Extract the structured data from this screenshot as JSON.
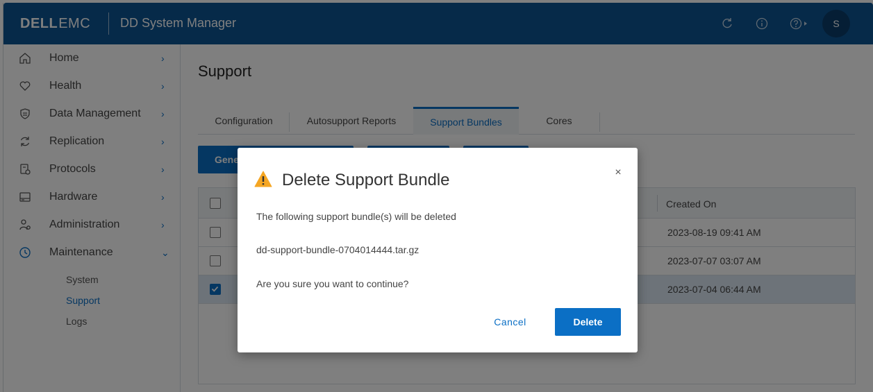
{
  "header": {
    "brand_dell": "DELL",
    "brand_emc": "EMC",
    "app_title": "DD System Manager",
    "avatar_initial": "S",
    "icons": [
      "refresh-icon",
      "info-icon",
      "help-icon"
    ]
  },
  "sidebar": {
    "items": [
      {
        "label": "Home",
        "icon": "home-icon"
      },
      {
        "label": "Health",
        "icon": "heart-icon"
      },
      {
        "label": "Data Management",
        "icon": "shield-icon"
      },
      {
        "label": "Replication",
        "icon": "replication-icon"
      },
      {
        "label": "Protocols",
        "icon": "protocols-icon"
      },
      {
        "label": "Hardware",
        "icon": "drive-icon"
      },
      {
        "label": "Administration",
        "icon": "admin-user-icon"
      },
      {
        "label": "Maintenance",
        "icon": "clock-icon"
      }
    ],
    "sub_items": [
      "System",
      "Support",
      "Logs"
    ],
    "active_sub": "Support"
  },
  "main": {
    "page_title": "Support",
    "tabs": [
      "Configuration",
      "Autosupport Reports",
      "Support Bundles",
      "Cores"
    ],
    "active_tab": "Support Bundles",
    "toolbar": {
      "generate_label": "Gene"
    },
    "table": {
      "header_created_on": "Created On",
      "rows": [
        {
          "created_on": "2023-08-19 09:41 AM",
          "checked": false
        },
        {
          "created_on": "2023-07-07 03:07 AM",
          "checked": false
        },
        {
          "created_on": "2023-07-04 06:44 AM",
          "checked": true
        }
      ]
    }
  },
  "modal": {
    "title": "Delete Support Bundle",
    "message": "The following support bundle(s) will be deleted",
    "bundle_name": "dd-support-bundle-0704014444.tar.gz",
    "confirm_text": "Are you sure you want to continue?",
    "cancel_label": "Cancel",
    "delete_label": "Delete",
    "close_symbol": "×"
  },
  "colors": {
    "header_bg": "#0d5593",
    "accent": "#0b6fc5",
    "warning": "#f5a623"
  }
}
